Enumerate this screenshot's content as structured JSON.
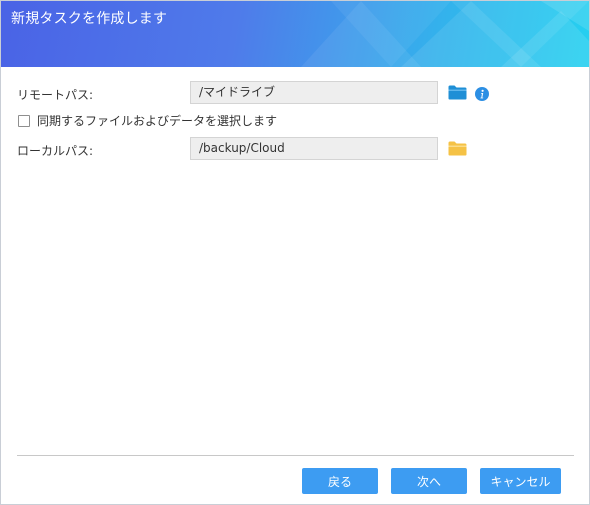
{
  "dialog": {
    "title": "新規タスクを作成します"
  },
  "remote_path": {
    "label": "リモートパス:",
    "value": "/マイドライブ",
    "folder_icon": "folder-icon",
    "info_icon": "info-icon"
  },
  "sync_select": {
    "label": "同期するファイルおよびデータを選択します",
    "checked": false
  },
  "local_path": {
    "label": "ローカルパス:",
    "value": "/backup/Cloud",
    "folder_icon": "folder-icon"
  },
  "footer": {
    "back_label": "戻る",
    "next_label": "次へ",
    "cancel_label": "キャンセル"
  },
  "colors": {
    "primary_button": "#3d9cf2",
    "header_gradient_start": "#4a63e6",
    "header_gradient_end": "#25d0f0",
    "remote_folder": "#1f8fd6",
    "local_folder": "#f5c245"
  }
}
